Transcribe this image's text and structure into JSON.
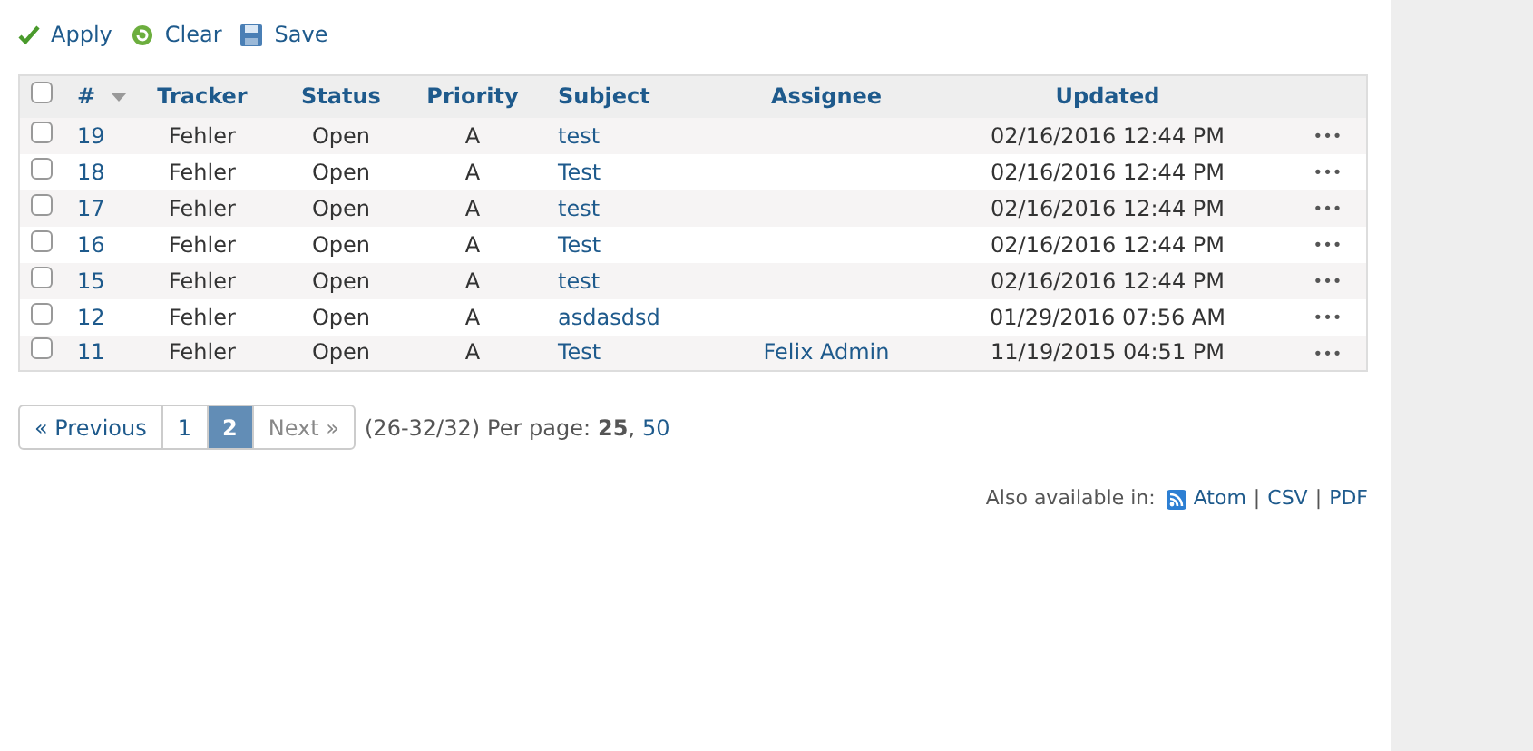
{
  "toolbar": [
    {
      "kind": "apply",
      "label": "Apply"
    },
    {
      "kind": "clear",
      "label": "Clear"
    },
    {
      "kind": "save",
      "label": "Save"
    }
  ],
  "table": {
    "all_checked": false,
    "columns": [
      {
        "label": "#",
        "sorted": true
      },
      {
        "label": "Tracker",
        "sorted": false
      },
      {
        "label": "Status",
        "sorted": false
      },
      {
        "label": "Priority",
        "sorted": false
      },
      {
        "label": "Subject",
        "sorted": false
      },
      {
        "label": "Assignee",
        "sorted": false
      },
      {
        "label": "Updated",
        "sorted": false
      }
    ],
    "rows": [
      {
        "checked": false,
        "id": "19",
        "tracker": "Fehler",
        "status": "Open",
        "priority": "A",
        "subject": "test",
        "updated": "02/16/2016 12:44 PM",
        "menu": "•••"
      },
      {
        "checked": false,
        "id": "18",
        "tracker": "Fehler",
        "status": "Open",
        "priority": "A",
        "subject": "Test",
        "updated": "02/16/2016 12:44 PM",
        "menu": "•••"
      },
      {
        "checked": false,
        "id": "17",
        "tracker": "Fehler",
        "status": "Open",
        "priority": "A",
        "subject": "test",
        "updated": "02/16/2016 12:44 PM",
        "menu": "•••"
      },
      {
        "checked": false,
        "id": "16",
        "tracker": "Fehler",
        "status": "Open",
        "priority": "A",
        "subject": "Test",
        "updated": "02/16/2016 12:44 PM",
        "menu": "•••"
      },
      {
        "checked": false,
        "id": "15",
        "tracker": "Fehler",
        "status": "Open",
        "priority": "A",
        "subject": "test",
        "updated": "02/16/2016 12:44 PM",
        "menu": "•••"
      },
      {
        "checked": false,
        "id": "12",
        "tracker": "Fehler",
        "status": "Open",
        "priority": "A",
        "subject": "asdasdsd",
        "updated": "01/29/2016 07:56 AM",
        "menu": "•••"
      },
      {
        "checked": false,
        "id": "11",
        "tracker": "Fehler",
        "status": "Open",
        "priority": "A",
        "subject": "Test",
        "assignee": "Felix Admin",
        "updated": "11/19/2015 04:51 PM",
        "menu": "•••"
      }
    ]
  },
  "pagination": {
    "previous": {
      "label": "« Previous",
      "disabled": false
    },
    "pages": [
      {
        "label": "1",
        "selected": false
      },
      {
        "label": "2",
        "selected": true
      }
    ],
    "next": {
      "label": "Next »",
      "disabled": true
    },
    "summary": "(26-32/32)",
    "per_page_label": "Per page:",
    "per_page_separator": ",",
    "per_page": [
      {
        "label": "25",
        "selected": true
      },
      {
        "label": "50",
        "selected": false
      }
    ]
  },
  "export": {
    "label": "Also available in:",
    "separator": "|",
    "formats": [
      {
        "label": "Atom",
        "kind": "feed"
      },
      {
        "label": "CSV"
      },
      {
        "label": "PDF"
      }
    ]
  }
}
